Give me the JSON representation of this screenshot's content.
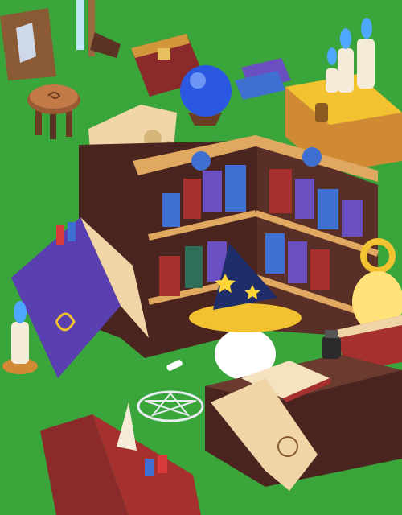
{
  "scene": {
    "background": "#3aa53a",
    "objects": [
      "weapon-rack",
      "wooden-stool",
      "treasure-chest",
      "crystal-ball",
      "scroll-pile",
      "l-shaped-bookshelf",
      "golden-chest-with-candles",
      "magic-tome",
      "candle-left",
      "wizard-character",
      "pentagram-rune",
      "chalk",
      "writing-desk",
      "open-book",
      "long-scroll",
      "ink-pot",
      "oil-lantern",
      "stacked-books",
      "spell-book-bottom"
    ]
  },
  "colors": {
    "grass": "#3aa53a",
    "shelf_wood": "#5a2f27",
    "shelf_trim": "#e0a860",
    "book_blue": "#3f6fd0",
    "book_purple": "#6a4fc0",
    "book_red": "#a6302e",
    "gold": "#f2c230",
    "wizard_hat": "#1f2e6b",
    "hat_star": "#ffd53a",
    "parchment": "#f0d5a6",
    "flame_blue": "#4fa8ff",
    "crystal": "#2a58e0"
  }
}
